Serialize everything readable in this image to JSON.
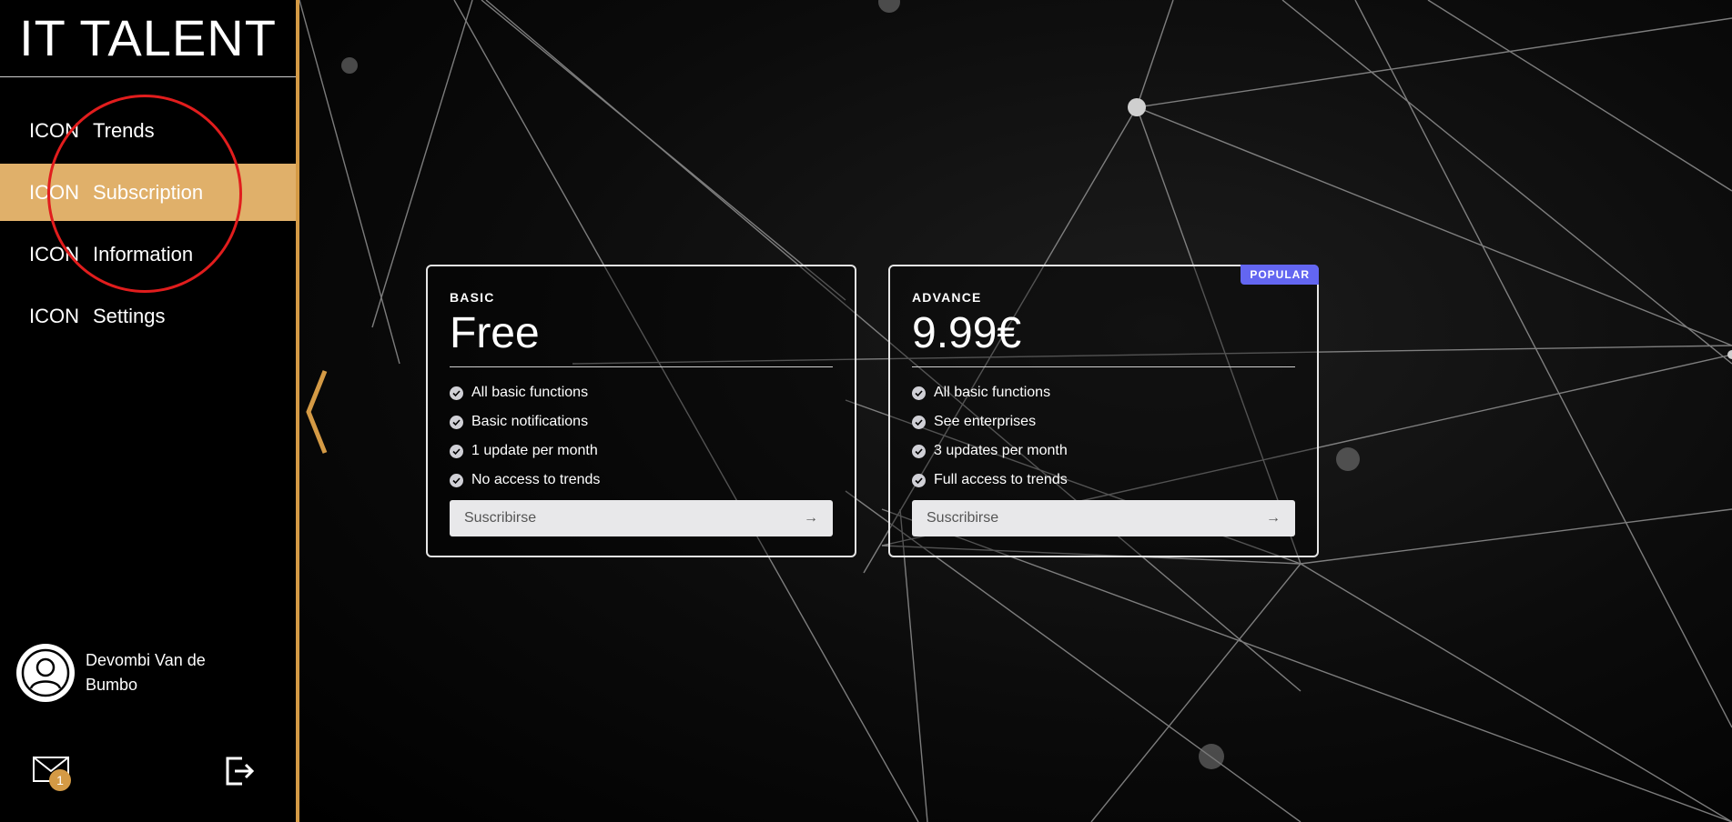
{
  "brand": {
    "title": "IT TALENT"
  },
  "sidebar": {
    "items": [
      {
        "icon": "ICON",
        "label": "Trends"
      },
      {
        "icon": "ICON",
        "label": "Subscription"
      },
      {
        "icon": "ICON",
        "label": "Information"
      },
      {
        "icon": "ICON",
        "label": "Settings"
      }
    ],
    "active_index": 1
  },
  "user": {
    "name": "Devombi Van de Bumbo",
    "avatar_icon": "user-avatar-icon"
  },
  "footer": {
    "mail_icon": "mail-icon",
    "mail_count": "1",
    "logout_icon": "logout-icon"
  },
  "plans": [
    {
      "name": "BASIC",
      "price": "Free",
      "features": [
        "All basic functions",
        "Basic notifications",
        "1 update per month",
        "No access to trends"
      ],
      "button_label": "Suscribirse"
    },
    {
      "name": "ADVANCE",
      "price": "9.99€",
      "badge": "POPULAR",
      "features": [
        "All basic functions",
        "See enterprises",
        "3 updates per month",
        "Full access to trends"
      ],
      "button_label": "Suscribirse"
    }
  ],
  "colors": {
    "accent": "#d49a45",
    "active_item": "#e0b06a",
    "popular_badge": "#6366f1",
    "highlight_circle": "#e11d1d"
  }
}
